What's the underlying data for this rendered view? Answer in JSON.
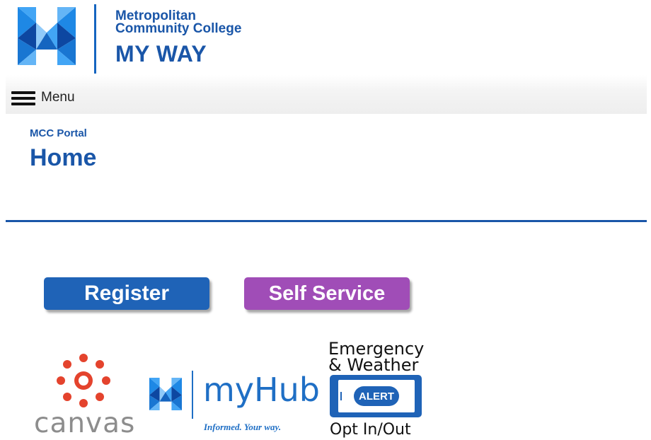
{
  "header": {
    "college_line1": "Metropolitan",
    "college_line2": "Community College",
    "portal_name": "MY WAY",
    "logo_icon": "mcc-logo-icon",
    "brand_color": "#1a56a8"
  },
  "menu": {
    "label": "Menu",
    "icon": "hamburger-icon"
  },
  "page": {
    "breadcrumb": "MCC Portal",
    "title": "Home"
  },
  "buttons": {
    "register": {
      "label": "Register",
      "color": "#1f63b7"
    },
    "self_service": {
      "label": "Self Service",
      "color": "#a04db7"
    }
  },
  "tiles": {
    "canvas": {
      "wordmark": "canvas",
      "icon": "canvas-logo-icon",
      "accent": "#e4432d"
    },
    "myhub": {
      "wordmark": "myHub",
      "tagline": "Informed. Your way.",
      "icon": "mcc-logo-icon"
    },
    "alert": {
      "heading_line1": "Emergency",
      "heading_line2": "& Weather",
      "badge": "ALERT",
      "footer": "Opt In/Out",
      "icon": "phone-alert-icon"
    }
  }
}
